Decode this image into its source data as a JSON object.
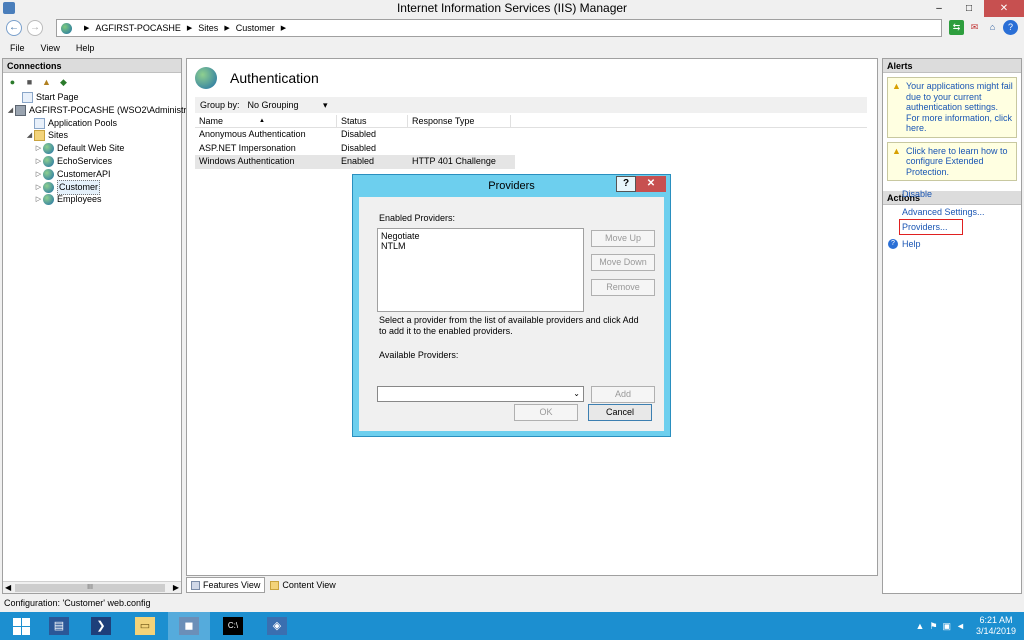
{
  "window": {
    "title": "Internet Information Services (IIS) Manager",
    "min": "–",
    "max": "□",
    "close": "✕"
  },
  "address": {
    "path": [
      "AGFIRST-POCASHE",
      "Sites",
      "Customer"
    ],
    "back": "←",
    "forward": "→",
    "tools": [
      "⇆",
      "✉",
      "⌂",
      "?"
    ]
  },
  "menu": [
    "File",
    "View",
    "Help"
  ],
  "connections": {
    "header": "Connections",
    "tree": [
      {
        "label": "Start Page",
        "icon": "start-page-icon",
        "expander": ""
      },
      {
        "label": "AGFIRST-POCASHE (WSO2\\Administrat",
        "icon": "server-icon",
        "expander": "◢"
      },
      {
        "label": "Application Pools",
        "icon": "app-pools-icon",
        "expander": ""
      },
      {
        "label": "Sites",
        "icon": "sites-folder-icon",
        "expander": "◢"
      },
      {
        "label": "Default Web Site",
        "icon": "globe-icon",
        "expander": "▷"
      },
      {
        "label": "EchoServices",
        "icon": "globe-icon",
        "expander": "▷"
      },
      {
        "label": "CustomerAPI",
        "icon": "globe-icon",
        "expander": "▷"
      },
      {
        "label": "Customer",
        "icon": "globe-icon",
        "expander": "▷"
      },
      {
        "label": "Employees",
        "icon": "globe-icon",
        "expander": "▷"
      }
    ],
    "scrollbar_thumb": "III"
  },
  "center": {
    "title": "Authentication",
    "group_by_label": "Group by:",
    "group_by_value": "No Grouping",
    "columns": [
      "Name",
      "Status",
      "Response Type"
    ],
    "rows": [
      [
        "Anonymous Authentication",
        "Disabled",
        ""
      ],
      [
        "ASP.NET Impersonation",
        "Disabled",
        ""
      ],
      [
        "Windows Authentication",
        "Enabled",
        "HTTP 401 Challenge"
      ]
    ],
    "tabs": [
      "Features View",
      "Content View"
    ]
  },
  "right": {
    "alerts_header": "Alerts",
    "alerts": [
      "Your applications might fail due to your current authentication settings.  For more information, click here.",
      "Click here to learn how to configure Extended Protection."
    ],
    "actions_header": "Actions",
    "actions": [
      "Disable",
      "Advanced Settings...",
      "Providers...",
      "Help"
    ]
  },
  "statusbar": "Configuration: 'Customer' web.config",
  "dialog": {
    "title": "Providers",
    "help": "?",
    "close": "✕",
    "enabled_label": "Enabled Providers:",
    "enabled_providers": [
      "Negotiate",
      "NTLM"
    ],
    "move_up": "Move Up",
    "move_down": "Move Down",
    "remove": "Remove",
    "hint": "Select a provider from the list of available providers and click Add to add it to the enabled providers.",
    "available_label": "Available Providers:",
    "available_value": "",
    "add": "Add",
    "ok": "OK",
    "cancel": "Cancel"
  },
  "taskbar": {
    "time": "6:21 AM",
    "date": "3/14/2019"
  },
  "colors": {
    "dialog_frame": "#6dcfee",
    "taskbar": "#1c8fd0",
    "link": "#1a56b4",
    "highlight_box": "#e02020"
  }
}
